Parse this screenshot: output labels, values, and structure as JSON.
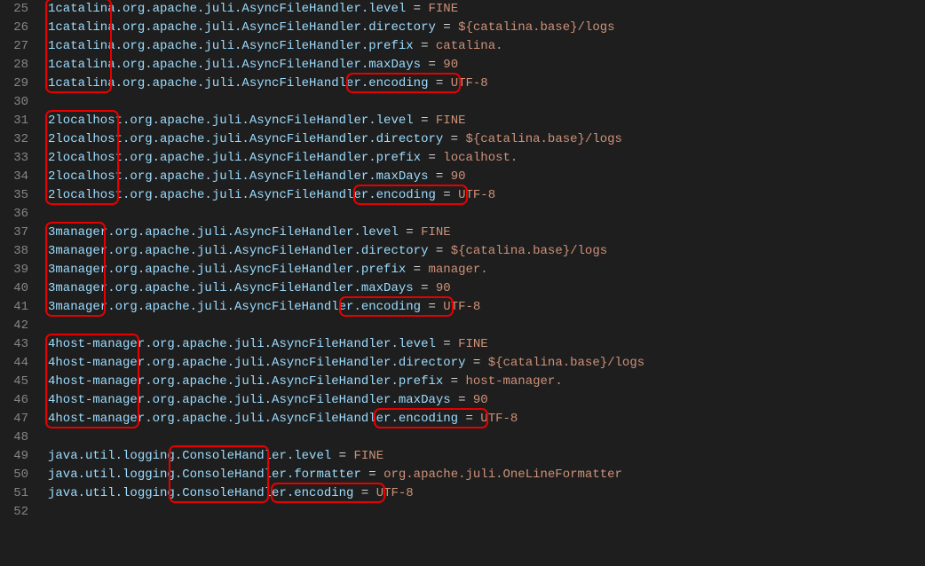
{
  "editor": {
    "startLine": 25,
    "lines": [
      {
        "prefix": "1catalina",
        "mid": ".org.apache.juli.AsyncFileHandler.",
        "prop": "level",
        "val": "FINE"
      },
      {
        "prefix": "1catalina",
        "mid": ".org.apache.juli.AsyncFileHandler.",
        "prop": "directory",
        "val": "${catalina.base}/logs"
      },
      {
        "prefix": "1catalina",
        "mid": ".org.apache.juli.AsyncFileHandler.",
        "prop": "prefix",
        "val": "catalina."
      },
      {
        "prefix": "1catalina",
        "mid": ".org.apache.juli.AsyncFileHandler.",
        "prop": "maxDays",
        "val": "90"
      },
      {
        "prefix": "1catalina",
        "mid": ".org.apache.juli.AsyncFileHandler.",
        "prop": "encoding",
        "val": "UTF-8"
      },
      {
        "blank": true
      },
      {
        "prefix": "2localhost",
        "mid": ".org.apache.juli.AsyncFileHandler.",
        "prop": "level",
        "val": "FINE"
      },
      {
        "prefix": "2localhost",
        "mid": ".org.apache.juli.AsyncFileHandler.",
        "prop": "directory",
        "val": "${catalina.base}/logs"
      },
      {
        "prefix": "2localhost",
        "mid": ".org.apache.juli.AsyncFileHandler.",
        "prop": "prefix",
        "val": "localhost."
      },
      {
        "prefix": "2localhost",
        "mid": ".org.apache.juli.AsyncFileHandler.",
        "prop": "maxDays",
        "val": "90"
      },
      {
        "prefix": "2localhost",
        "mid": ".org.apache.juli.AsyncFileHandler.",
        "prop": "encoding",
        "val": "UTF-8"
      },
      {
        "blank": true
      },
      {
        "prefix": "3manager",
        "mid": ".org.apache.juli.AsyncFileHandler.",
        "prop": "level",
        "val": "FINE"
      },
      {
        "prefix": "3manager",
        "mid": ".org.apache.juli.AsyncFileHandler.",
        "prop": "directory",
        "val": "${catalina.base}/logs"
      },
      {
        "prefix": "3manager",
        "mid": ".org.apache.juli.AsyncFileHandler.",
        "prop": "prefix",
        "val": "manager."
      },
      {
        "prefix": "3manager",
        "mid": ".org.apache.juli.AsyncFileHandler.",
        "prop": "maxDays",
        "val": "90"
      },
      {
        "prefix": "3manager",
        "mid": ".org.apache.juli.AsyncFileHandler.",
        "prop": "encoding",
        "val": "UTF-8"
      },
      {
        "blank": true
      },
      {
        "prefix": "4host-manager",
        "mid": ".org.apache.juli.AsyncFileHandler.",
        "prop": "level",
        "val": "FINE"
      },
      {
        "prefix": "4host-manager",
        "mid": ".org.apache.juli.AsyncFileHandler.",
        "prop": "directory",
        "val": "${catalina.base}/logs"
      },
      {
        "prefix": "4host-manager",
        "mid": ".org.apache.juli.AsyncFileHandler.",
        "prop": "prefix",
        "val": "host-manager."
      },
      {
        "prefix": "4host-manager",
        "mid": ".org.apache.juli.AsyncFileHandler.",
        "prop": "maxDays",
        "val": "90"
      },
      {
        "prefix": "4host-manager",
        "mid": ".org.apache.juli.AsyncFileHandler.",
        "prop": "encoding",
        "val": "UTF-8"
      },
      {
        "blank": true
      },
      {
        "prefix": "java.util.logging.",
        "mid": "ConsoleHandler.",
        "prop": "level",
        "val": "FINE",
        "noLeadDot": true
      },
      {
        "prefix": "java.util.logging.",
        "mid": "ConsoleHandler.",
        "prop": "formatter",
        "val": "org.apache.juli.OneLineFormatter",
        "noLeadDot": true
      },
      {
        "prefix": "java.util.logging.",
        "mid": "ConsoleHandler.",
        "prop": "encoding",
        "val": "UTF-8",
        "noLeadDot": true
      },
      {
        "blank": true
      }
    ]
  },
  "annotations": [
    {
      "name": "box-1catalina",
      "lineStart": 25,
      "lineEnd": 29,
      "colStart": 0,
      "colEnd": 9
    },
    {
      "name": "box-encoding-1",
      "lineStart": 29,
      "lineEnd": 29,
      "colStart": 44,
      "colEnd": 60
    },
    {
      "name": "box-2localhost",
      "lineStart": 31,
      "lineEnd": 35,
      "colStart": 0,
      "colEnd": 10
    },
    {
      "name": "box-encoding-2",
      "lineStart": 35,
      "lineEnd": 35,
      "colStart": 45,
      "colEnd": 61
    },
    {
      "name": "box-3manager",
      "lineStart": 37,
      "lineEnd": 41,
      "colStart": 0,
      "colEnd": 8
    },
    {
      "name": "box-encoding-3",
      "lineStart": 41,
      "lineEnd": 41,
      "colStart": 43,
      "colEnd": 59
    },
    {
      "name": "box-4hostmanager",
      "lineStart": 43,
      "lineEnd": 47,
      "colStart": 0,
      "colEnd": 13
    },
    {
      "name": "box-encoding-4",
      "lineStart": 47,
      "lineEnd": 47,
      "colStart": 48,
      "colEnd": 64
    },
    {
      "name": "box-consolehandler",
      "lineStart": 49,
      "lineEnd": 51,
      "colStart": 18,
      "colEnd": 32
    },
    {
      "name": "box-encoding-5",
      "lineStart": 51,
      "lineEnd": 51,
      "colStart": 33,
      "colEnd": 49
    }
  ],
  "layout": {
    "charWidth": 7.7,
    "lineHeight": 21,
    "codeLeft": 54,
    "topOffset": 0
  }
}
